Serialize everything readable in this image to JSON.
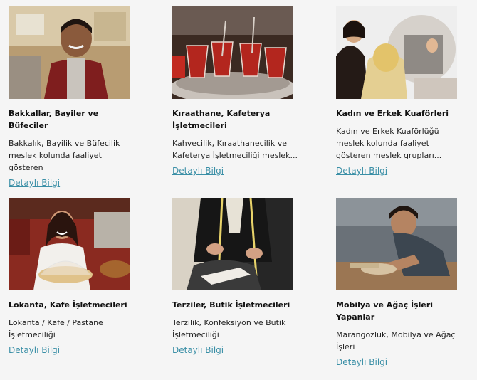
{
  "cards": [
    {
      "title": "Bakkallar, Bayiler ve Büfeciler",
      "desc": "Bakkalık, Bayilik ve Büfecilik meslek kolunda faaliyet gösteren",
      "link": "Detaylı Bilgi",
      "image": "grocer-photo"
    },
    {
      "title": "Kıraathane, Kafeterya İşletmecileri",
      "desc": "Kahvecilik, Kıraathanecilik ve Kafeterya İşletmeciliği meslek...",
      "link": "Detaylı Bilgi",
      "image": "tea-glasses-photo"
    },
    {
      "title": "Kadın ve Erkek Kuaförleri",
      "desc": "Kadın ve Erkek Kuaförlüğü meslek kolunda faaliyet gösteren meslek grupları...",
      "link": "Detaylı Bilgi",
      "image": "hairdresser-photo"
    },
    {
      "title": "Lokanta, Kafe İşletmecileri",
      "desc": "Lokanta / Kafe / Pastane İşletmeciliği",
      "link": "Detaylı Bilgi",
      "image": "cafe-owner-photo"
    },
    {
      "title": "Terziler, Butik İşletmecileri",
      "desc": "Terzilik, Konfeksiyon ve Butik İşletmeciliği",
      "link": "Detaylı Bilgi",
      "image": "tailor-photo"
    },
    {
      "title": "Mobilya ve Ağaç İşleri Yapanlar",
      "desc": "Marangozluk, Mobilya ve Ağaç İşleri",
      "link": "Detaylı Bilgi",
      "image": "carpenter-photo"
    }
  ],
  "colors": {
    "background": "#f5f5f5",
    "link": "#3a8fa6",
    "title": "#111111"
  }
}
